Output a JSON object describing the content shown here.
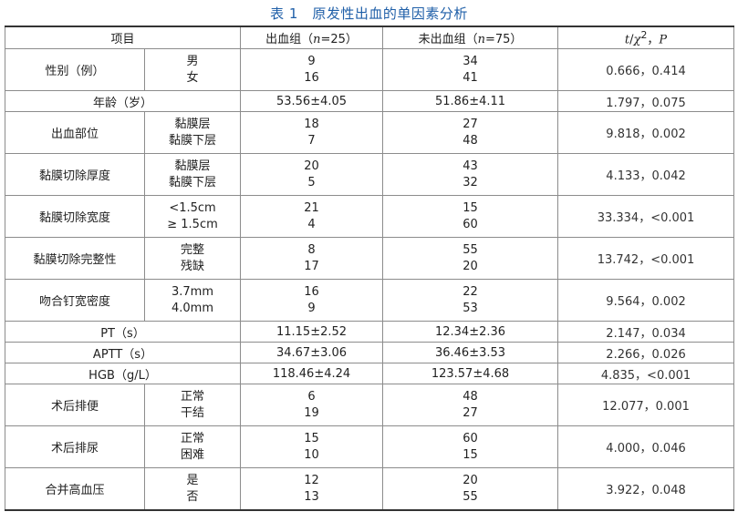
{
  "caption": "表 1　原发性出血的单因素分析",
  "header": {
    "item": "项目",
    "bleed_pre": "出血组（",
    "bleed_n": "n",
    "bleed_post": "=25）",
    "nobleed_pre": "未出血组（",
    "nobleed_n": "n",
    "nobleed_post": "=75）",
    "stat_t": "t",
    "stat_sep": "/",
    "stat_chi": "χ",
    "stat_sq": "2",
    "stat_comma": "，",
    "stat_p": "P"
  },
  "rows": [
    {
      "name": "性别（例）",
      "sub": [
        "男",
        "女"
      ],
      "bleed": [
        "9",
        "16"
      ],
      "nobleed": [
        "34",
        "41"
      ],
      "stat": "0.666，0.414"
    },
    {
      "name": "年龄（岁）",
      "bleed": "53.56±4.05",
      "nobleed": "51.86±4.11",
      "stat": "1.797，0.075"
    },
    {
      "name": "出血部位",
      "sub": [
        "黏膜层",
        "黏膜下层"
      ],
      "bleed": [
        "18",
        "7"
      ],
      "nobleed": [
        "27",
        "48"
      ],
      "stat": "9.818，0.002"
    },
    {
      "name": "黏膜切除厚度",
      "sub": [
        "黏膜层",
        "黏膜下层"
      ],
      "bleed": [
        "20",
        "5"
      ],
      "nobleed": [
        "43",
        "32"
      ],
      "stat": "4.133，0.042"
    },
    {
      "name": "黏膜切除宽度",
      "sub": [
        "<1.5cm",
        "≥ 1.5cm"
      ],
      "bleed": [
        "21",
        "4"
      ],
      "nobleed": [
        "15",
        "60"
      ],
      "stat": "33.334，<0.001"
    },
    {
      "name": "黏膜切除完整性",
      "sub": [
        "完整",
        "残缺"
      ],
      "bleed": [
        "8",
        "17"
      ],
      "nobleed": [
        "55",
        "20"
      ],
      "stat": "13.742，<0.001"
    },
    {
      "name": "吻合钉宽密度",
      "sub": [
        "3.7mm",
        "4.0mm"
      ],
      "bleed": [
        "16",
        "9"
      ],
      "nobleed": [
        "22",
        "53"
      ],
      "stat": "9.564，0.002"
    },
    {
      "name": "PT（s）",
      "bleed": "11.15±2.52",
      "nobleed": "12.34±2.36",
      "stat": "2.147，0.034"
    },
    {
      "name": "APTT（s）",
      "bleed": "34.67±3.06",
      "nobleed": "36.46±3.53",
      "stat": "2.266，0.026"
    },
    {
      "name": "HGB（g/L）",
      "bleed": "118.46±4.24",
      "nobleed": "123.57±4.68",
      "stat": "4.835，<0.001"
    },
    {
      "name": "术后排便",
      "sub": [
        "正常",
        "干结"
      ],
      "bleed": [
        "6",
        "19"
      ],
      "nobleed": [
        "48",
        "27"
      ],
      "stat": "12.077，0.001"
    },
    {
      "name": "术后排尿",
      "sub": [
        "正常",
        "困难"
      ],
      "bleed": [
        "15",
        "10"
      ],
      "nobleed": [
        "60",
        "15"
      ],
      "stat": "4.000，0.046"
    },
    {
      "name": "合并高血压",
      "sub": [
        "是",
        "否"
      ],
      "bleed": [
        "12",
        "13"
      ],
      "nobleed": [
        "20",
        "55"
      ],
      "stat": "3.922，0.048"
    }
  ]
}
